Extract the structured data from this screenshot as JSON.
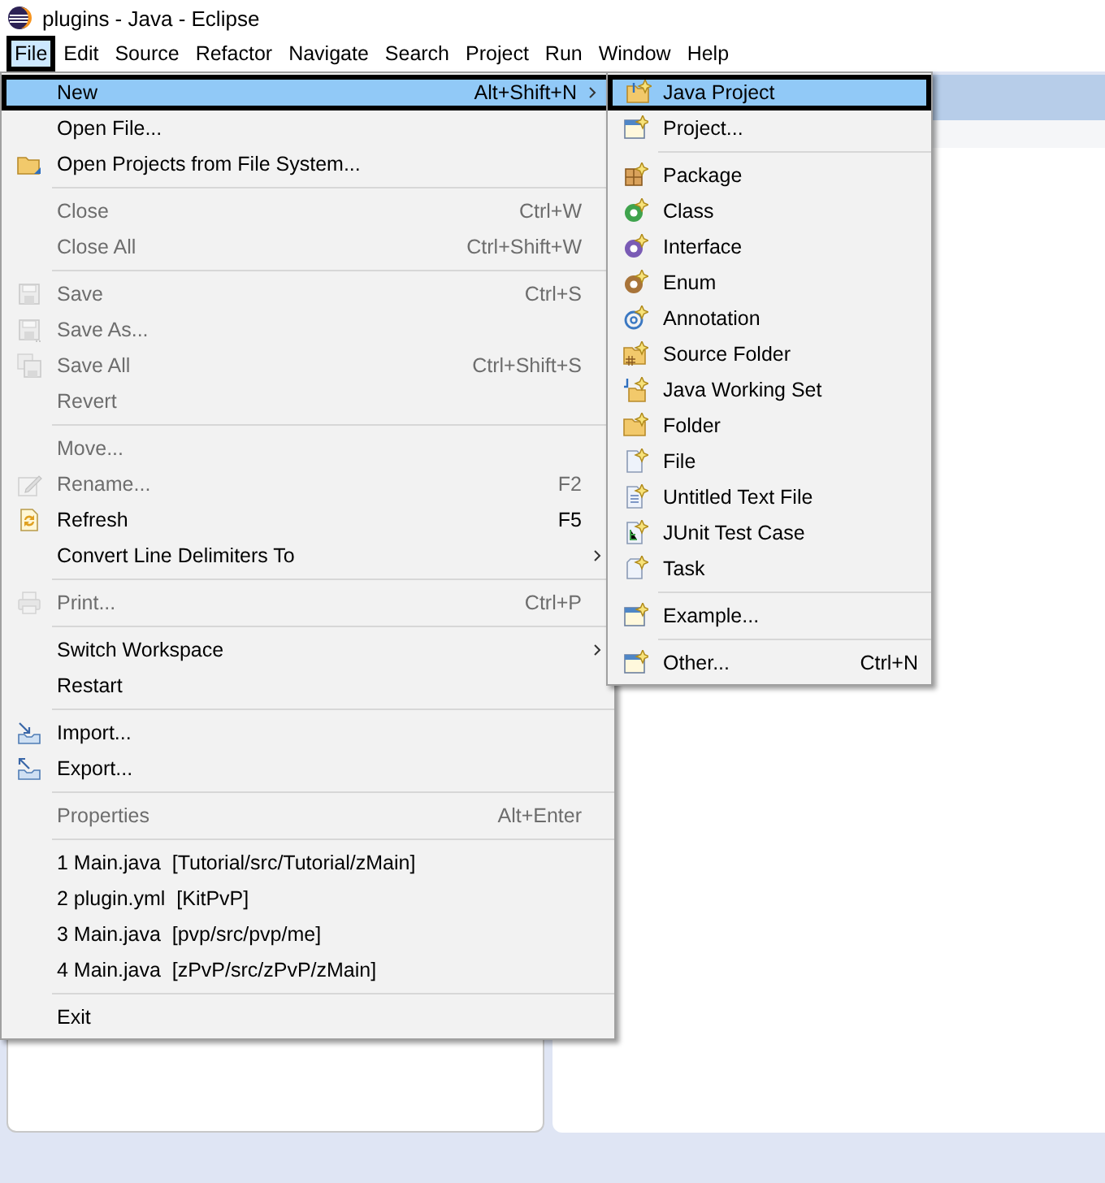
{
  "window": {
    "title": "plugins - Java - Eclipse"
  },
  "menu_bar": [
    {
      "label": "File",
      "selected": true
    },
    {
      "label": "Edit",
      "selected": false
    },
    {
      "label": "Source",
      "selected": false
    },
    {
      "label": "Refactor",
      "selected": false
    },
    {
      "label": "Navigate",
      "selected": false
    },
    {
      "label": "Search",
      "selected": false
    },
    {
      "label": "Project",
      "selected": false
    },
    {
      "label": "Run",
      "selected": false
    },
    {
      "label": "Window",
      "selected": false
    },
    {
      "label": "Help",
      "selected": false
    }
  ],
  "file_menu": {
    "items": [
      {
        "kind": "item",
        "label": "New",
        "shortcut": "Alt+Shift+N",
        "submenu": true,
        "disabled": false,
        "selected": true
      },
      {
        "kind": "item",
        "label": "Open File...",
        "disabled": false,
        "selected": false
      },
      {
        "kind": "item",
        "label": "Open Projects from File System...",
        "disabled": false,
        "selected": false
      },
      {
        "kind": "separator"
      },
      {
        "kind": "item",
        "label": "Close",
        "shortcut": "Ctrl+W",
        "disabled": true,
        "selected": false
      },
      {
        "kind": "item",
        "label": "Close All",
        "shortcut": "Ctrl+Shift+W",
        "disabled": true,
        "selected": false
      },
      {
        "kind": "separator"
      },
      {
        "kind": "item",
        "label": "Save",
        "shortcut": "Ctrl+S",
        "disabled": true,
        "selected": false
      },
      {
        "kind": "item",
        "label": "Save As...",
        "disabled": true,
        "selected": false
      },
      {
        "kind": "item",
        "label": "Save All",
        "shortcut": "Ctrl+Shift+S",
        "disabled": true,
        "selected": false
      },
      {
        "kind": "item",
        "label": "Revert",
        "disabled": true,
        "selected": false
      },
      {
        "kind": "separator"
      },
      {
        "kind": "item",
        "label": "Move...",
        "disabled": true,
        "selected": false
      },
      {
        "kind": "item",
        "label": "Rename...",
        "shortcut": "F2",
        "disabled": true,
        "selected": false
      },
      {
        "kind": "item",
        "label": "Refresh",
        "shortcut": "F5",
        "disabled": false,
        "selected": false
      },
      {
        "kind": "item",
        "label": "Convert Line Delimiters To",
        "submenu": true,
        "disabled": false,
        "selected": false
      },
      {
        "kind": "separator"
      },
      {
        "kind": "item",
        "label": "Print...",
        "shortcut": "Ctrl+P",
        "disabled": true,
        "selected": false
      },
      {
        "kind": "separator"
      },
      {
        "kind": "item",
        "label": "Switch Workspace",
        "submenu": true,
        "disabled": false,
        "selected": false
      },
      {
        "kind": "item",
        "label": "Restart",
        "disabled": false,
        "selected": false
      },
      {
        "kind": "separator"
      },
      {
        "kind": "item",
        "label": "Import...",
        "disabled": false,
        "selected": false
      },
      {
        "kind": "item",
        "label": "Export...",
        "disabled": false,
        "selected": false
      },
      {
        "kind": "separator"
      },
      {
        "kind": "item",
        "label": "Properties",
        "shortcut": "Alt+Enter",
        "disabled": true,
        "selected": false
      },
      {
        "kind": "separator"
      },
      {
        "kind": "item",
        "label": "1 Main.java  [Tutorial/src/Tutorial/zMain]",
        "disabled": false,
        "selected": false
      },
      {
        "kind": "item",
        "label": "2 plugin.yml  [KitPvP]",
        "disabled": false,
        "selected": false
      },
      {
        "kind": "item",
        "label": "3 Main.java  [pvp/src/pvp/me]",
        "disabled": false,
        "selected": false
      },
      {
        "kind": "item",
        "label": "4 Main.java  [zPvP/src/zPvP/zMain]",
        "disabled": false,
        "selected": false
      },
      {
        "kind": "separator"
      },
      {
        "kind": "item",
        "label": "Exit",
        "disabled": false,
        "selected": false
      }
    ]
  },
  "new_submenu": {
    "items": [
      {
        "kind": "item",
        "label": "Java Project",
        "disabled": false,
        "selected": true
      },
      {
        "kind": "item",
        "label": "Project...",
        "disabled": false,
        "selected": false
      },
      {
        "kind": "separator"
      },
      {
        "kind": "item",
        "label": "Package",
        "disabled": false,
        "selected": false
      },
      {
        "kind": "item",
        "label": "Class",
        "disabled": false,
        "selected": false
      },
      {
        "kind": "item",
        "label": "Interface",
        "disabled": false,
        "selected": false
      },
      {
        "kind": "item",
        "label": "Enum",
        "disabled": false,
        "selected": false
      },
      {
        "kind": "item",
        "label": "Annotation",
        "disabled": false,
        "selected": false
      },
      {
        "kind": "item",
        "label": "Source Folder",
        "disabled": false,
        "selected": false
      },
      {
        "kind": "item",
        "label": "Java Working Set",
        "disabled": false,
        "selected": false
      },
      {
        "kind": "item",
        "label": "Folder",
        "disabled": false,
        "selected": false
      },
      {
        "kind": "item",
        "label": "File",
        "disabled": false,
        "selected": false
      },
      {
        "kind": "item",
        "label": "Untitled Text File",
        "disabled": false,
        "selected": false
      },
      {
        "kind": "item",
        "label": "JUnit Test Case",
        "disabled": false,
        "selected": false
      },
      {
        "kind": "item",
        "label": "Task",
        "disabled": false,
        "selected": false
      },
      {
        "kind": "separator"
      },
      {
        "kind": "item",
        "label": "Example...",
        "disabled": false,
        "selected": false
      },
      {
        "kind": "separator"
      },
      {
        "kind": "item",
        "label": "Other...",
        "shortcut": "Ctrl+N",
        "disabled": false,
        "selected": false
      }
    ]
  }
}
